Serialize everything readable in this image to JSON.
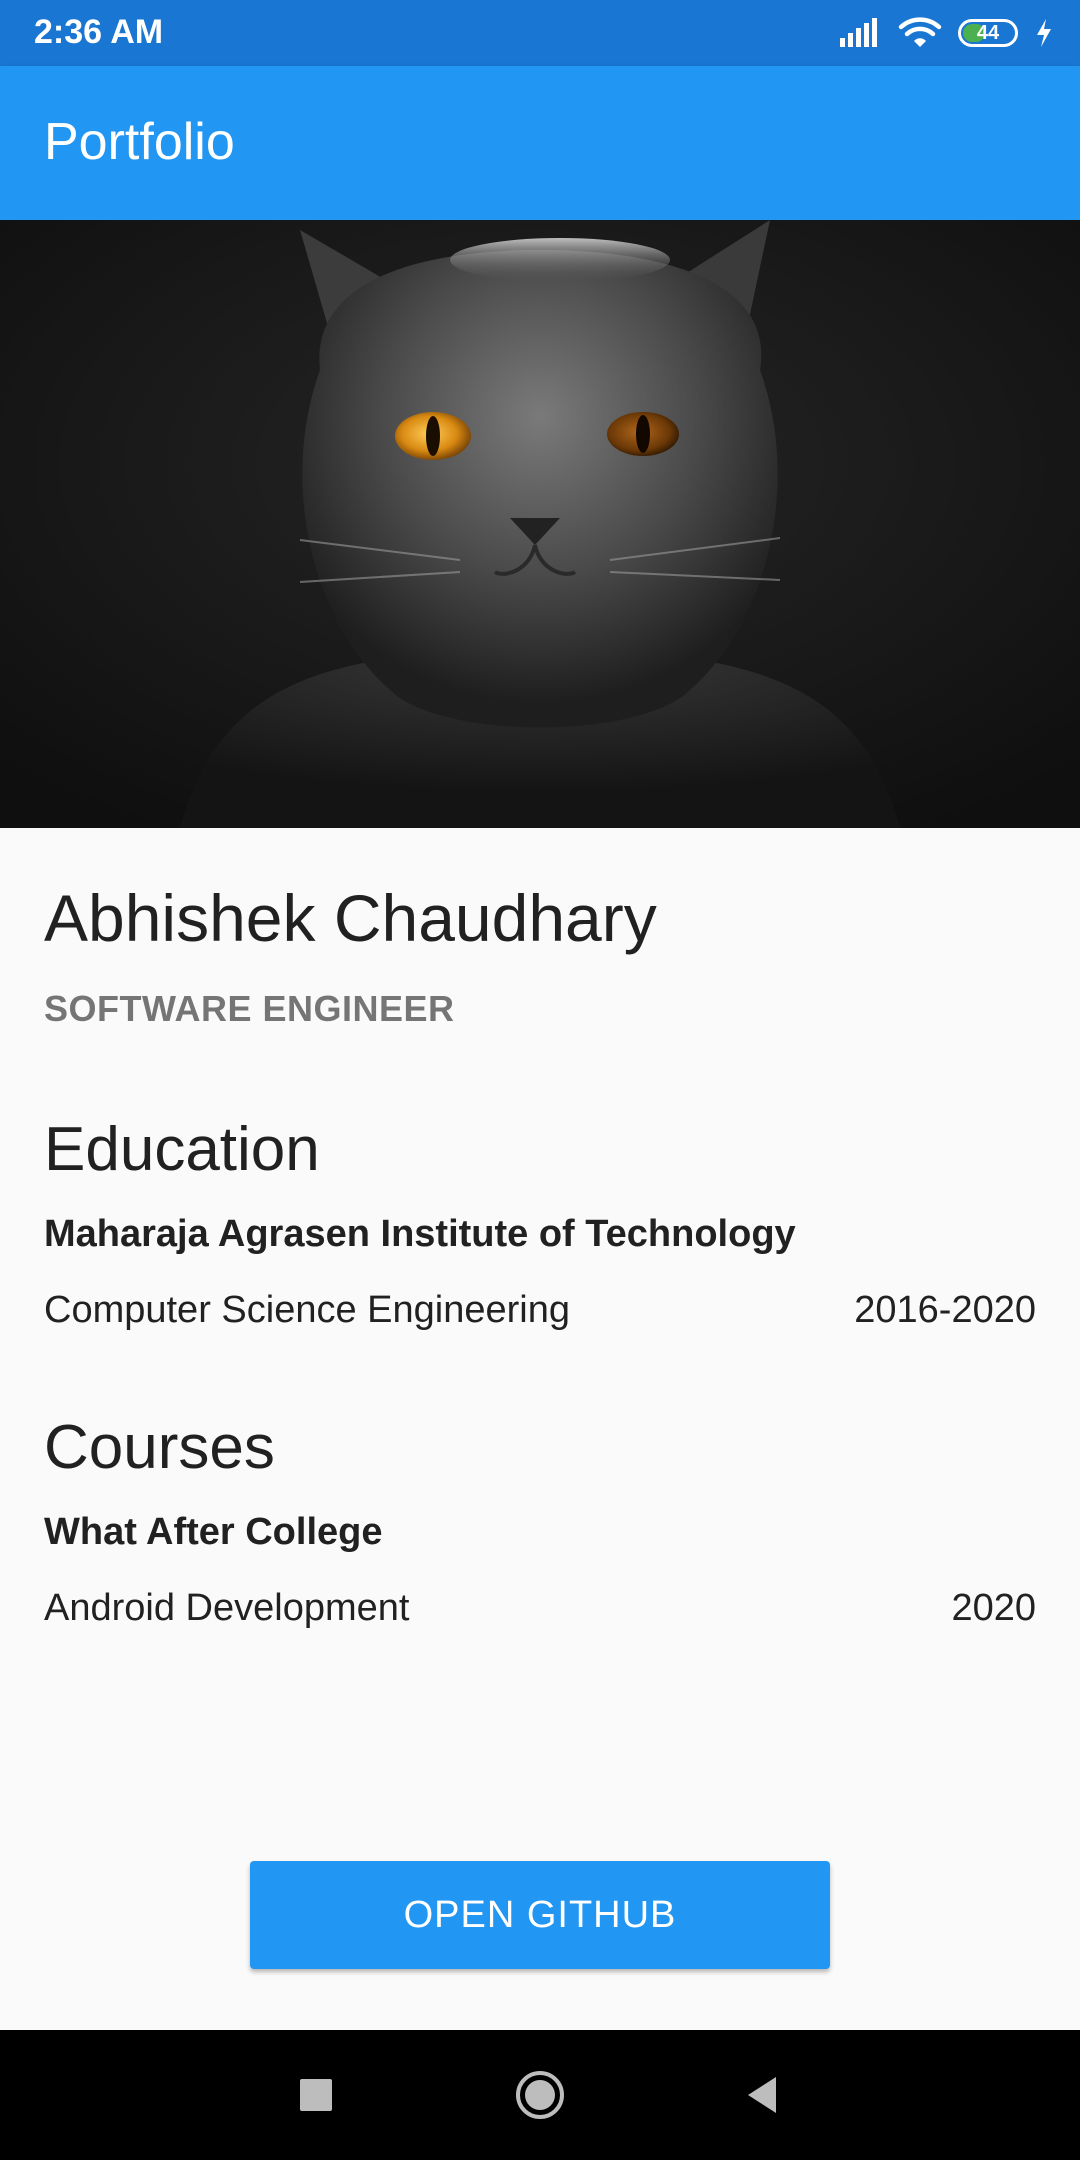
{
  "status_bar": {
    "time": "2:36 AM",
    "battery": "44",
    "icons": [
      "signal-icon",
      "wifi-icon",
      "battery-icon",
      "charging-icon"
    ]
  },
  "app_bar": {
    "title": "Portfolio",
    "color": "#2196f3"
  },
  "hero": {
    "image": "cat-portrait"
  },
  "profile": {
    "name": "Abhishek Chaudhary",
    "role": "SOFTWARE ENGINEER"
  },
  "education": {
    "title": "Education",
    "institution": "Maharaja Agrasen Institute of Technology",
    "course": "Computer Science Engineering",
    "years": "2016-2020"
  },
  "courses": {
    "title": "Courses",
    "provider": "What After College",
    "course": "Android Development",
    "year": "2020"
  },
  "github_button": {
    "label": "OPEN GITHUB",
    "color": "#2196f3"
  },
  "nav_bar": {
    "icons": [
      "recents-icon",
      "home-icon",
      "back-icon"
    ]
  }
}
